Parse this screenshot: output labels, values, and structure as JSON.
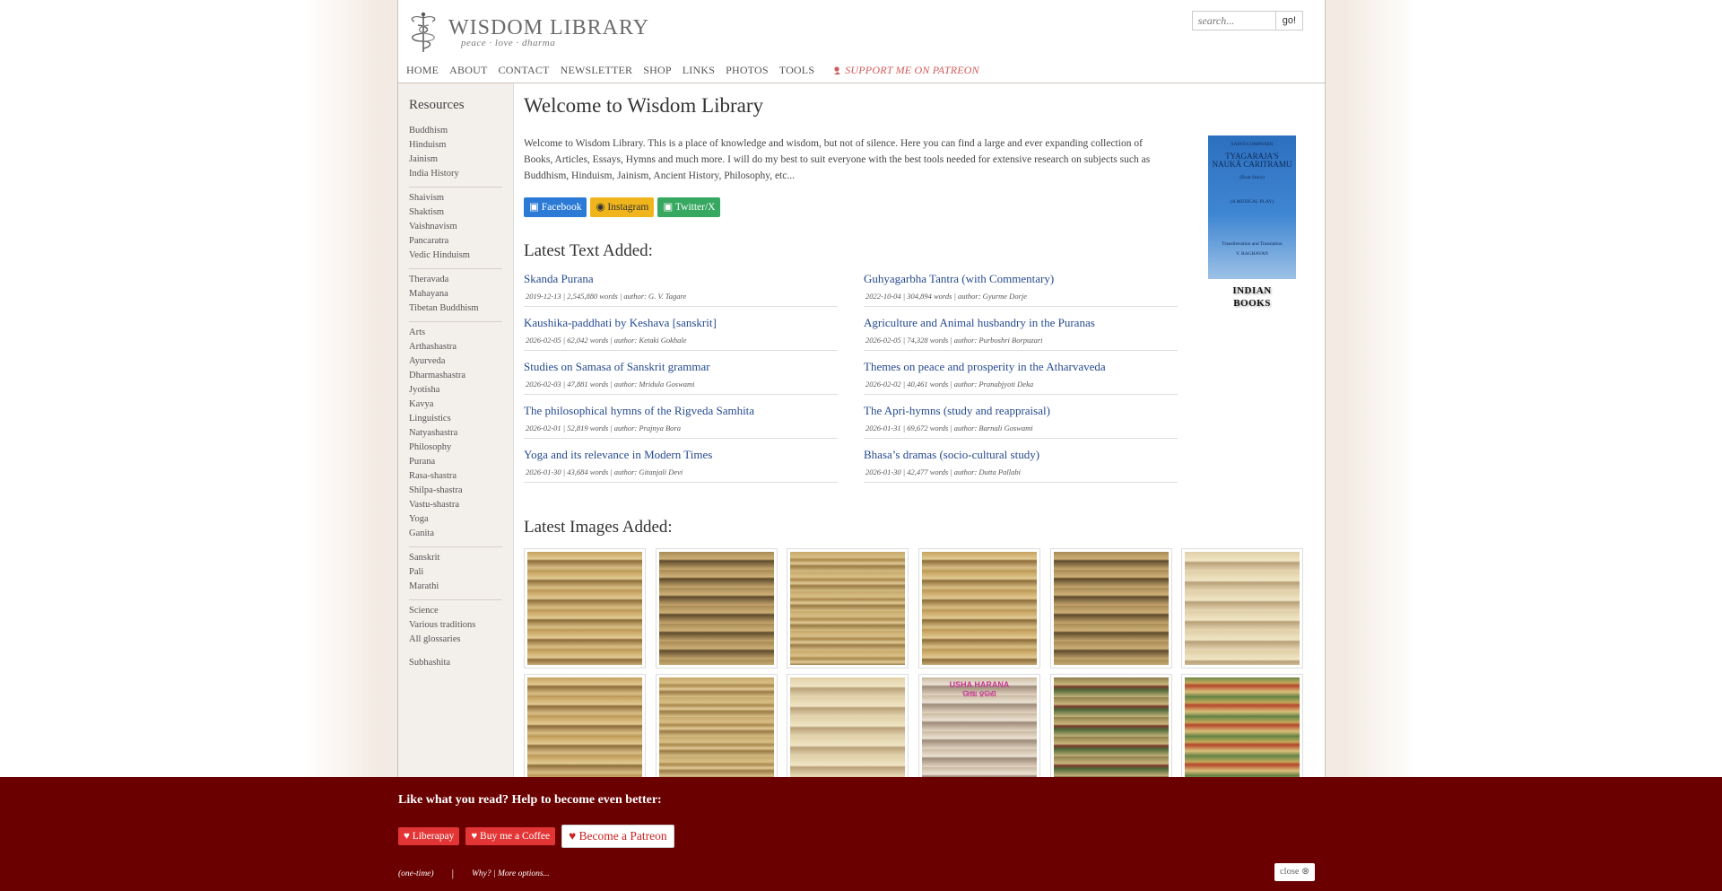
{
  "header": {
    "title": "WISDOM LIBRARY",
    "tagline": "peace · love · dharma",
    "search_placeholder": "search...",
    "search_button": "go!"
  },
  "nav": {
    "items": [
      "HOME",
      "ABOUT",
      "CONTACT",
      "NEWSLETTER",
      "SHOP",
      "LINKS",
      "PHOTOS",
      "TOOLS"
    ],
    "patreon": "SUPPORT ME ON PATREON"
  },
  "sidebar": {
    "heading": "Resources",
    "groups": [
      [
        "Buddhism",
        "Hinduism",
        "Jainism",
        "India History"
      ],
      [
        "Shaivism",
        "Shaktism",
        "Vaishnavism",
        "Pancaratra",
        "Vedic Hinduism"
      ],
      [
        "Theravada",
        "Mahayana",
        "Tibetan Buddhism"
      ],
      [
        "Arts",
        "Arthashastra",
        "Ayurveda",
        "Dharmashastra",
        "Jyotisha",
        "Kavya",
        "Linguistics",
        "Natyashastra",
        "Philosophy",
        "Purana",
        "Rasa-shastra",
        "Shilpa-shastra",
        "Vastu-shastra",
        "Yoga",
        "Ganita"
      ],
      [
        "Sanskrit",
        "Pali",
        "Marathi"
      ],
      [
        "Science",
        "Various traditions",
        "All glossaries"
      ],
      [
        "Subhashita"
      ]
    ]
  },
  "main": {
    "title": "Welcome to Wisdom Library",
    "intro": "Welcome to Wisdom Library. This is a place of knowledge and wisdom, but not of silence. Here you can find a large and ever expanding collection of Books, Articles, Essays, Hymns and much more. I will do my best to suit everyone with the best tools needed for extensive research on subjects such as Buddhism, Hinduism, Jainism, Ancient History, Philosophy, etc...",
    "social": {
      "facebook": "Facebook",
      "instagram": "Instagram",
      "twitter": "Twitter/X"
    },
    "book": {
      "cover_lines": [
        "SAINT-COMPOSER",
        "TYAGARAJA'S",
        "NAUKĀ CARITRAMU",
        "(Boat Story)",
        "(A MUSICAL PLAY)",
        "Transliteration and Translation",
        "V. RAGHAVAN"
      ],
      "label_line1": "INDIAN",
      "label_line2": "BOOKS"
    },
    "latest_text_heading": "Latest Text Added:",
    "latest_texts": [
      {
        "title": "Skanda Purana",
        "meta": "2019-12-13 | 2,545,880 words | author: G. V. Tagare"
      },
      {
        "title": "Guhyagarbha Tantra (with Commentary)",
        "meta": "2022-10-04 | 304,894 words | author: Gyurme Dorje"
      },
      {
        "title": "Kaushika-paddhati by Keshava [sanskrit]",
        "meta": "2026-02-05 | 62,042 words | author: Ketaki Gokhale"
      },
      {
        "title": "Agriculture and Animal husbandry in the Puranas",
        "meta": "2026-02-05 | 74,328 words | author: Purboshri Borpuzari"
      },
      {
        "title": "Studies on Samasa of Sanskrit grammar",
        "meta": "2026-02-03 | 47,881 words | author: Mridula Goswami"
      },
      {
        "title": "Themes on peace and prosperity in the Atharvaveda",
        "meta": "2026-02-02 | 40,461 words | author: Pranabjyoti Deka"
      },
      {
        "title": "The philosophical hymns of the Rigveda Samhita",
        "meta": "2026-02-01 | 52,819 words | author: Prajnya Bora"
      },
      {
        "title": "The Apri-hymns (study and reappraisal)",
        "meta": "2026-01-31 | 69,672 words | author: Barnali Goswami"
      },
      {
        "title": "Yoga and its relevance in Modern Times",
        "meta": "2026-01-30 | 43,684 words | author: Gitanjali Devi"
      },
      {
        "title": "Bhasa’s dramas (socio-cultural study)",
        "meta": "2026-01-30 | 42,477 words | author: Dutta Pallabi"
      }
    ],
    "latest_images_heading": "Latest Images Added:",
    "image_overlay_text": "USHA HARANA",
    "image_overlay_sub": "ଊଷା ହରଣ"
  },
  "banner": {
    "title": "Like what you read? Help to become even better:",
    "liberapay": "Liberapay",
    "coffee": "Buy me a Coffee",
    "patreon": "Become a Patreon",
    "one_time": "(one-time)",
    "separator": "|",
    "why": "Why? | More options...",
    "close": "close"
  },
  "colors": {
    "link": "#254a8f",
    "banner_bg": "#6b0000",
    "donate_button": "#e33535",
    "patreon_nav": "#d25a5a",
    "facebook": "#2b7bd6",
    "instagram": "#f0b51c",
    "twitter": "#36a860"
  }
}
